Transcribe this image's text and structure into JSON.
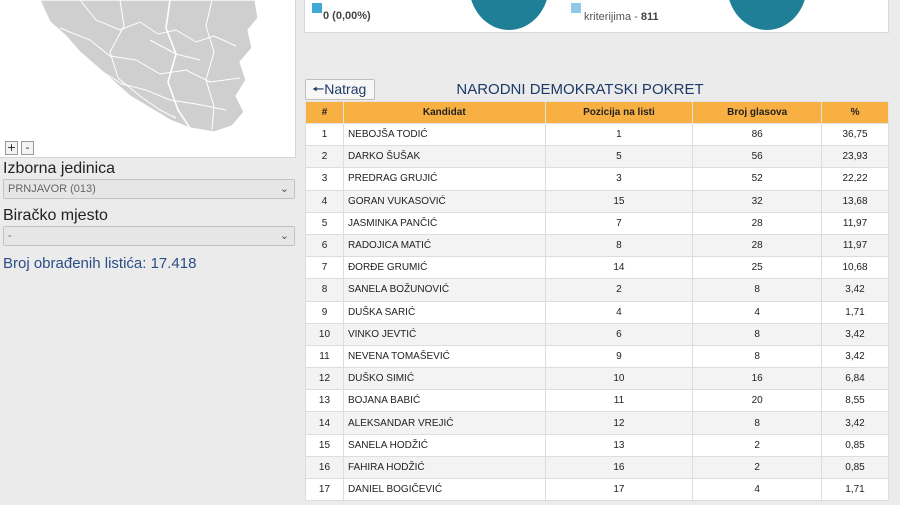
{
  "map": {
    "zoom_in": "+",
    "zoom_out": "-"
  },
  "filters": {
    "unit_label": "Izborna jedinica",
    "unit_value": "PRNJAVOR (013)",
    "station_label": "Biračko mjesto",
    "station_value": "-"
  },
  "processed": {
    "text": "Broj obrađenih listića: 17.418"
  },
  "stats": {
    "left_value": "0 (0,00%)",
    "right_label": "kriterijima - ",
    "right_value": "811",
    "colors": {
      "square": "#3fa9d4",
      "square_light": "#8fcbe7",
      "pie": "#1f7f96"
    }
  },
  "back_button": "Natrag",
  "party_title": "NARODNI DEMOKRATSKI POKRET",
  "table": {
    "headers": [
      "#",
      "Kandidat",
      "Pozicija na listi",
      "Broj glasova",
      "%"
    ],
    "header_color": "#f7b041",
    "rows": [
      [
        "1",
        "NEBOJŠA TODIĆ",
        "1",
        "86",
        "36,75"
      ],
      [
        "2",
        "DARKO ŠUŠAK",
        "5",
        "56",
        "23,93"
      ],
      [
        "3",
        "PREDRAG GRUJIĆ",
        "3",
        "52",
        "22,22"
      ],
      [
        "4",
        "GORAN VUKASOVIĆ",
        "15",
        "32",
        "13,68"
      ],
      [
        "5",
        "JASMINKA PANČIĆ",
        "7",
        "28",
        "11,97"
      ],
      [
        "6",
        "RADOJICA MATIĆ",
        "8",
        "28",
        "11,97"
      ],
      [
        "7",
        "ĐORĐE GRUMIĆ",
        "14",
        "25",
        "10,68"
      ],
      [
        "8",
        "SANELA BOŽUNOVIĆ",
        "2",
        "8",
        "3,42"
      ],
      [
        "9",
        "DUŠKA SARIĆ",
        "4",
        "4",
        "1,71"
      ],
      [
        "10",
        "VINKO JEVTIĆ",
        "6",
        "8",
        "3,42"
      ],
      [
        "11",
        "NEVENA TOMAŠEVIĆ",
        "9",
        "8",
        "3,42"
      ],
      [
        "12",
        "DUŠKO SIMIĆ",
        "10",
        "16",
        "6,84"
      ],
      [
        "13",
        "BOJANA BABIĆ",
        "11",
        "20",
        "8,55"
      ],
      [
        "14",
        "ALEKSANDAR VREJIĆ",
        "12",
        "8",
        "3,42"
      ],
      [
        "15",
        "SANELA HODŽIĆ",
        "13",
        "2",
        "0,85"
      ],
      [
        "16",
        "FAHIRA HODŽIĆ",
        "16",
        "2",
        "0,85"
      ],
      [
        "17",
        "DANIEL BOGIČEVIĆ",
        "17",
        "4",
        "1,71"
      ]
    ]
  }
}
